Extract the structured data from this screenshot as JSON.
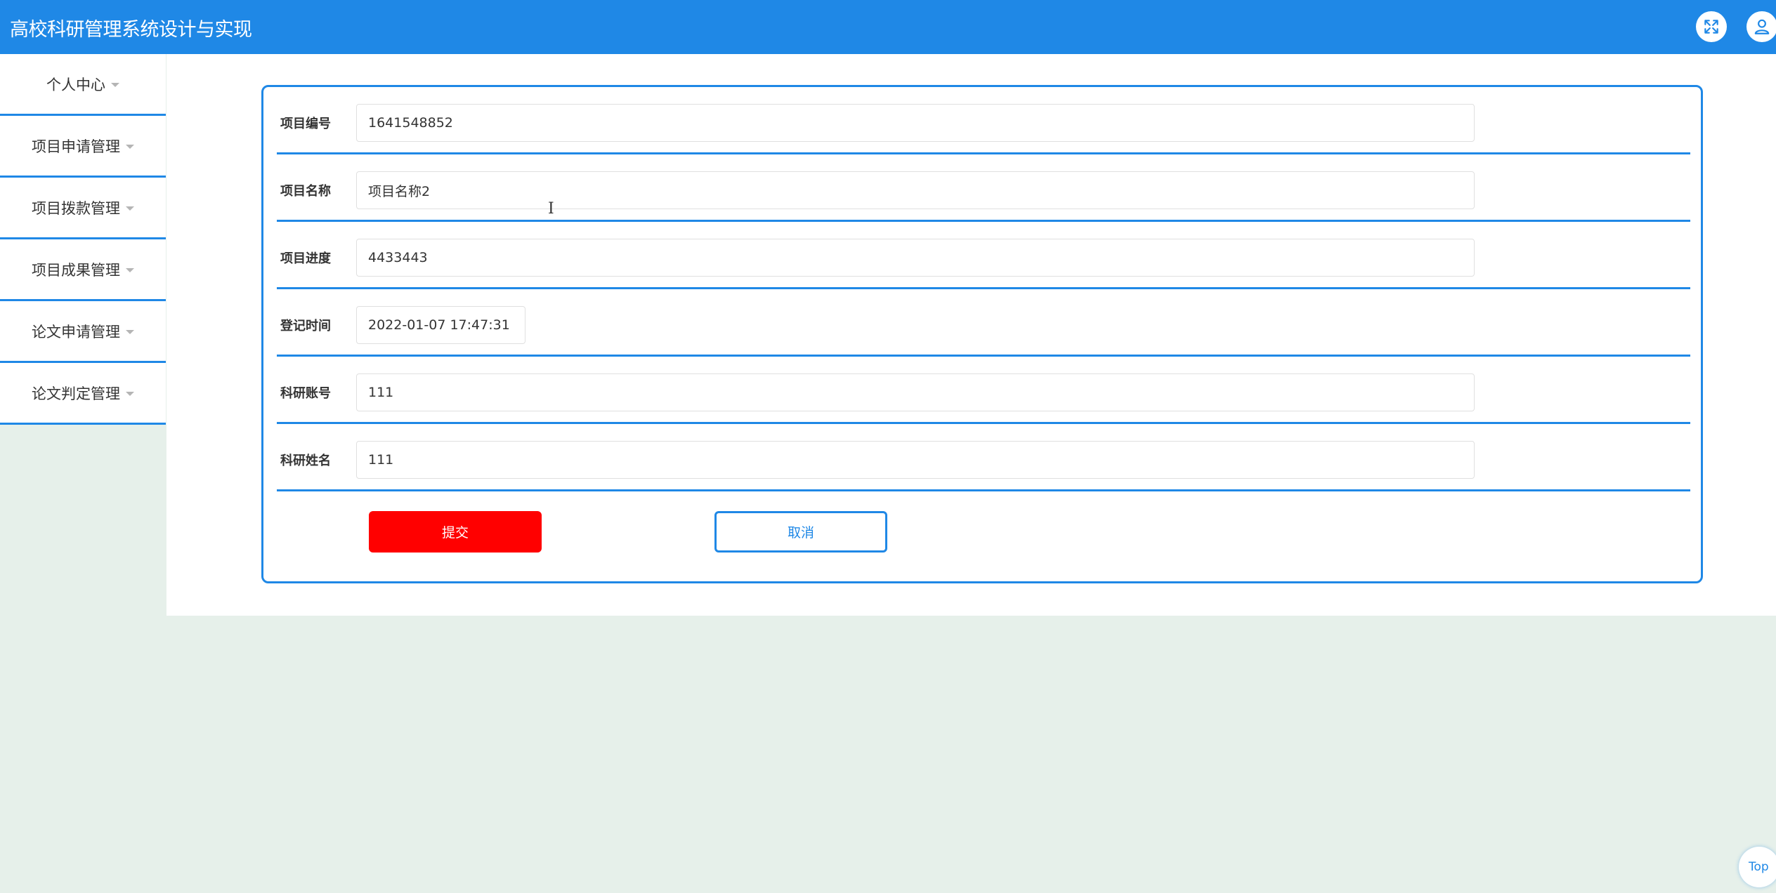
{
  "app": {
    "title": "高校科研管理系统设计与实现"
  },
  "header": {
    "expand_icon": "expand-icon",
    "user_icon": "user-icon"
  },
  "sidebar": {
    "items": [
      {
        "label": "个人中心"
      },
      {
        "label": "项目申请管理"
      },
      {
        "label": "项目拨款管理"
      },
      {
        "label": "项目成果管理"
      },
      {
        "label": "论文申请管理"
      },
      {
        "label": "论文判定管理"
      }
    ]
  },
  "form": {
    "fields": [
      {
        "label": "项目编号",
        "value": "1641548852"
      },
      {
        "label": "项目名称",
        "value": "项目名称2"
      },
      {
        "label": "项目进度",
        "value": "4433443"
      },
      {
        "label": "登记时间",
        "value": "2022-01-07 17:47:31"
      },
      {
        "label": "科研账号",
        "value": "111"
      },
      {
        "label": "科研姓名",
        "value": "111"
      }
    ],
    "submit_label": "提交",
    "cancel_label": "取消"
  },
  "back_to_top": {
    "label": "Top"
  },
  "colors": {
    "primary": "#1f88e6",
    "submit": "#ff0000",
    "background": "#e6f0ea"
  }
}
